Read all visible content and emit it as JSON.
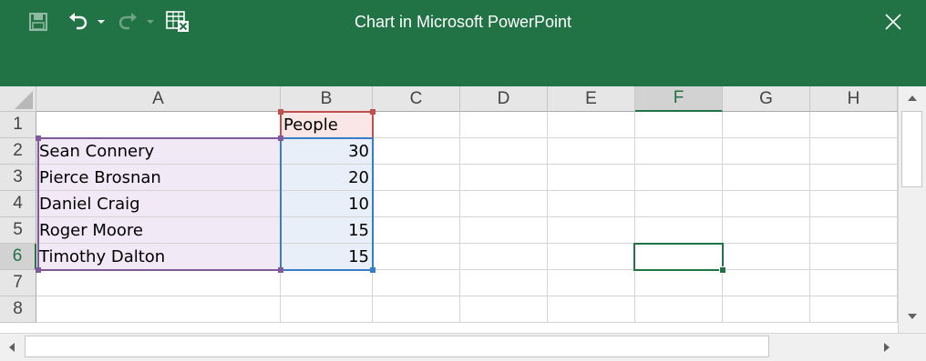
{
  "window": {
    "title": "Chart in Microsoft PowerPoint",
    "brand_color": "#217346"
  },
  "toolbar": {
    "icons": [
      "save-icon",
      "undo-icon",
      "undo-dropdown-icon",
      "redo-icon",
      "redo-dropdown-icon",
      "edit-data-in-excel-icon",
      "close-icon"
    ]
  },
  "sheet": {
    "columns": [
      "A",
      "B",
      "C",
      "D",
      "E",
      "F",
      "G",
      "H"
    ],
    "rows": [
      "1",
      "2",
      "3",
      "4",
      "5",
      "6",
      "7",
      "8"
    ],
    "selected_cell": "F6",
    "cells": {
      "B1": "People",
      "A2": "Sean Connery",
      "B2": "30",
      "A3": "Pierce Brosnan",
      "B3": "20",
      "A4": "Daniel Craig",
      "B4": "10",
      "A5": "Roger Moore",
      "B5": "15",
      "A6": "Timothy Dalton",
      "B6": "15"
    },
    "range_colors": {
      "series_name": "#c0504d",
      "categories": "#7f5a9b",
      "values": "#3a7cc9"
    }
  }
}
